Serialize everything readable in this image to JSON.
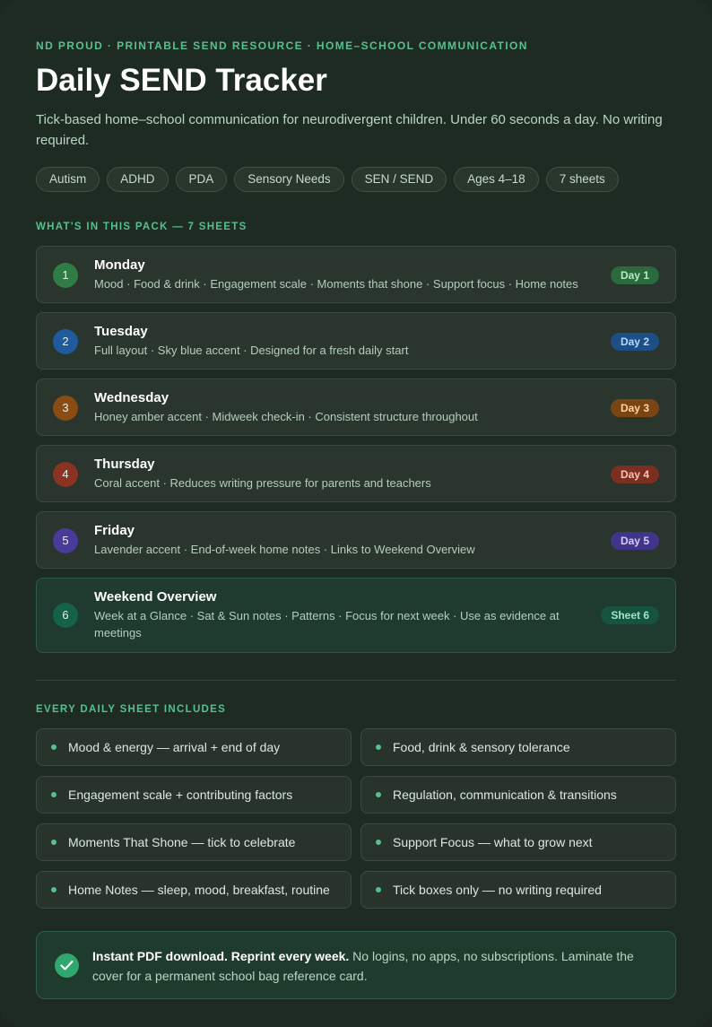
{
  "header": {
    "eyebrow": "ND PROUD · PRINTABLE SEND RESOURCE · HOME–SCHOOL COMMUNICATION",
    "title": "Daily SEND Tracker",
    "subtitle": "Tick-based home–school communication for neurodivergent children. Under 60 seconds a day. No writing required."
  },
  "tags": [
    "Autism",
    "ADHD",
    "PDA",
    "Sensory Needs",
    "SEN / SEND",
    "Ages 4–18",
    "7 sheets"
  ],
  "pack": {
    "label": "WHAT'S IN THIS PACK — 7 SHEETS",
    "items": [
      {
        "num": "1",
        "name": "Monday",
        "desc": "Mood · Food & drink · Engagement scale · Moments that shone · Support focus · Home notes",
        "badge": "Day 1",
        "accent": "#2f7d45",
        "badge_bg": "#2a6a3c",
        "badge_fg": "#b7ecc6"
      },
      {
        "num": "2",
        "name": "Tuesday",
        "desc": "Full layout · Sky blue accent · Designed for a fresh daily start",
        "badge": "Day 2",
        "accent": "#1f5a9e",
        "badge_bg": "#1d4f86",
        "badge_fg": "#b8d8ff"
      },
      {
        "num": "3",
        "name": "Wednesday",
        "desc": "Honey amber accent · Midweek check-in · Consistent structure throughout",
        "badge": "Day 3",
        "accent": "#8a4c12",
        "badge_bg": "#7a4512",
        "badge_fg": "#ffd3a0"
      },
      {
        "num": "4",
        "name": "Thursday",
        "desc": "Coral accent · Reduces writing pressure for parents and teachers",
        "badge": "Day 4",
        "accent": "#8a3322",
        "badge_bg": "#7c2e20",
        "badge_fg": "#ffc1b3"
      },
      {
        "num": "5",
        "name": "Friday",
        "desc": "Lavender accent · End-of-week home notes · Links to Weekend Overview",
        "badge": "Day 5",
        "accent": "#4a3a9a",
        "badge_bg": "#40358a",
        "badge_fg": "#d4ccff"
      },
      {
        "num": "6",
        "name": "Weekend Overview",
        "desc": "Week at a Glance · Sat & Sun notes · Patterns · Focus for next week · Use as evidence at meetings",
        "badge": "Sheet 6",
        "accent": "#15614a",
        "badge_bg": "#16543f",
        "badge_fg": "#9fe6c8"
      }
    ]
  },
  "features": {
    "label": "EVERY DAILY SHEET INCLUDES",
    "items": [
      "Mood & energy — arrival + end of day",
      "Food, drink & sensory tolerance",
      "Engagement scale + contributing factors",
      "Regulation, communication & transitions",
      "Moments That Shone — tick to celebrate",
      "Support Focus — what to grow next",
      "Home Notes — sleep, mood, breakfast, routine",
      "Tick boxes only — no writing required"
    ]
  },
  "footer": {
    "strong": "Instant PDF download. Reprint every week.",
    "text": " No logins, no apps, no subscriptions. Laminate the cover for a permanent school bag reference card."
  },
  "colors": {
    "accent": "#56c08e",
    "background": "#1e2b22"
  }
}
